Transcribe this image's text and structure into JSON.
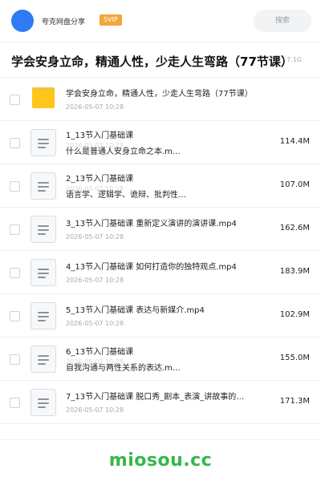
{
  "header": {
    "share_title": "夸克网盘分享",
    "badge": "SVIP",
    "search_placeholder": "搜索"
  },
  "folder": {
    "title": "学会安身立命，精通人性，少走人生弯路（77节课）",
    "meta": "· 7.1G"
  },
  "items": [
    {
      "type": "folder",
      "line1": "学会安身立命，精通人性，少走人生弯路（77节课）",
      "line2": "",
      "date": "2026-05-07 10:28",
      "size": ""
    },
    {
      "type": "file",
      "line1": "1_13节入门基础课",
      "line2": "什么是普通人安身立命之本.m…",
      "date": "2026-05-07 10:28",
      "size": "114.4M"
    },
    {
      "type": "file",
      "line1": "2_13节入门基础课",
      "line2": "语言学、逻辑学、诡辩、批判性…",
      "date": "2026-05-07 10:28",
      "size": "107.0M"
    },
    {
      "type": "file",
      "line1": "3_13节入门基础课 重新定义演讲的演讲课.mp4",
      "line2": "",
      "date": "2026-05-07 10:28",
      "size": "162.6M"
    },
    {
      "type": "file",
      "line1": "4_13节入门基础课 如何打造你的独特观点.mp4",
      "line2": "",
      "date": "2026-05-07 10:28",
      "size": "183.9M"
    },
    {
      "type": "file",
      "line1": "5_13节入门基础课 表达与新媒介.mp4",
      "line2": "",
      "date": "2026-05-07 10:28",
      "size": "102.9M"
    },
    {
      "type": "file",
      "line1": "6_13节入门基础课",
      "line2": "自我沟通与两性关系的表达.m…",
      "date": "2026-05-07 10:28",
      "size": "155.0M"
    },
    {
      "type": "file",
      "line1": "7_13节入门基础课 脱口秀_剧本_表演_讲故事的…",
      "line2": "",
      "date": "2026-05-07 10:28",
      "size": "171.3M"
    }
  ],
  "watermark": "miosou.cc"
}
